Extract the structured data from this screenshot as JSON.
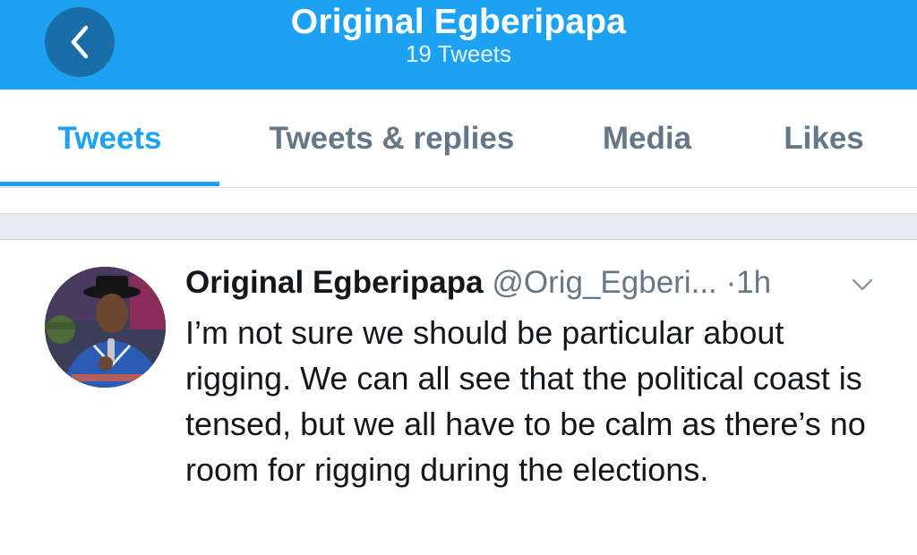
{
  "header": {
    "title": "Original Egberipapa",
    "subtitle": "19 Tweets",
    "back_icon": "chevron-left-icon",
    "colors": {
      "background": "#1da1f2",
      "back_button": "#1a6ea8"
    }
  },
  "tabs": [
    {
      "label": "Tweets",
      "active": true
    },
    {
      "label": "Tweets & replies",
      "active": false
    },
    {
      "label": "Media",
      "active": false
    },
    {
      "label": "Likes",
      "active": false
    }
  ],
  "tweet": {
    "display_name": "Original Egberipapa",
    "handle": "@Orig_Egberi...",
    "separator": "·",
    "time": "1h",
    "menu_icon": "chevron-down-icon",
    "text": "I’m not sure we should be particular about rigging. We can all see that the political coast is tensed, but we all have to be calm as there’s no room for rigging during the elections."
  },
  "colors": {
    "accent": "#1da1f2",
    "muted": "#657786",
    "text": "#14171a"
  }
}
